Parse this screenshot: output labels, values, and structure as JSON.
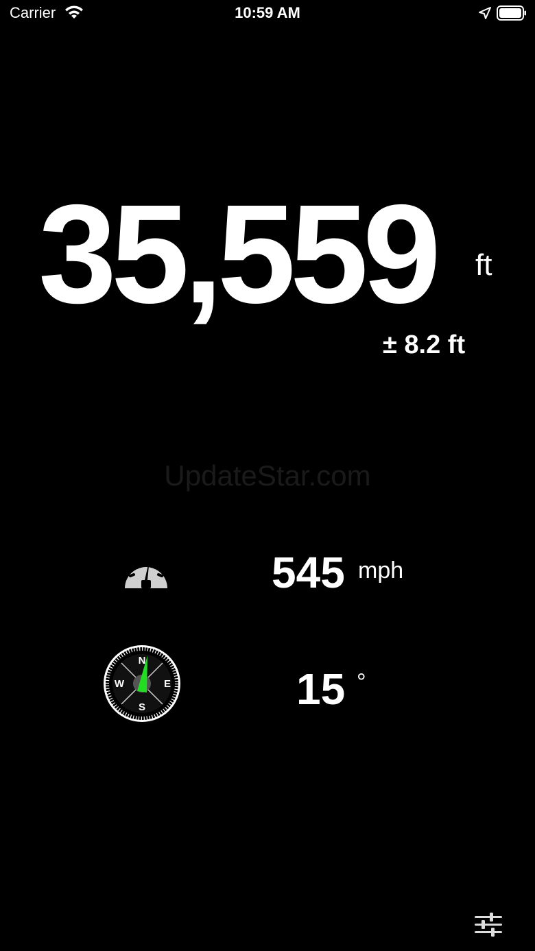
{
  "status_bar": {
    "carrier": "Carrier",
    "time": "10:59 AM"
  },
  "altitude": {
    "value": "35,559",
    "unit": "ft",
    "accuracy": "± 8.2 ft"
  },
  "watermark": "UpdateStar.com",
  "speed": {
    "icon": "speedometer-icon",
    "value": "545",
    "unit": "mph"
  },
  "heading": {
    "icon": "compass-icon",
    "value": "15",
    "unit": "°",
    "compass_labels": {
      "north": "N",
      "south": "S",
      "east": "E",
      "west": "W"
    }
  },
  "colors": {
    "background": "#000000",
    "text": "#ffffff",
    "compass_needle": "#22dd22",
    "speedometer": "#cfcfcf"
  }
}
